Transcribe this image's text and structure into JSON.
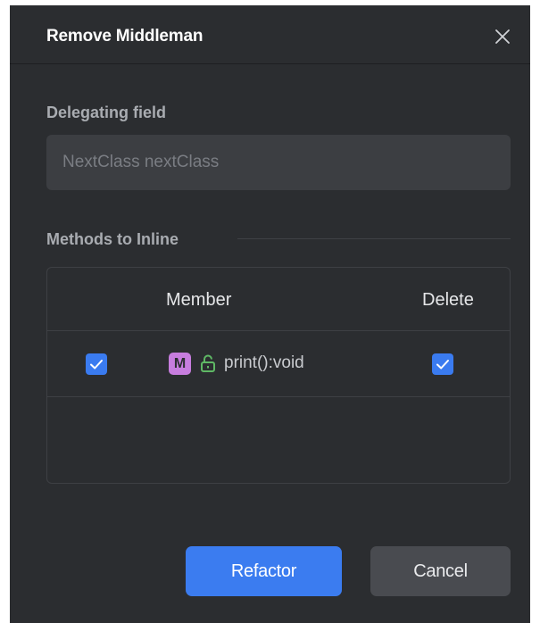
{
  "dialog": {
    "title": "Remove Middleman",
    "close_icon": "close-icon"
  },
  "delegating_field": {
    "label": "Delegating field",
    "value": "NextClass nextClass"
  },
  "methods": {
    "label": "Methods to Inline",
    "columns": [
      "Member",
      "Delete"
    ],
    "rows": [
      {
        "selected": true,
        "badge": "M",
        "access_icon": "unlocked-icon",
        "member": "print():void",
        "delete": true
      }
    ]
  },
  "buttons": {
    "refactor": "Refactor",
    "cancel": "Cancel"
  },
  "colors": {
    "background": "#2b2d30",
    "accent": "#3b7cf0",
    "method_badge": "#c77dde",
    "public_icon": "#5fb865"
  }
}
